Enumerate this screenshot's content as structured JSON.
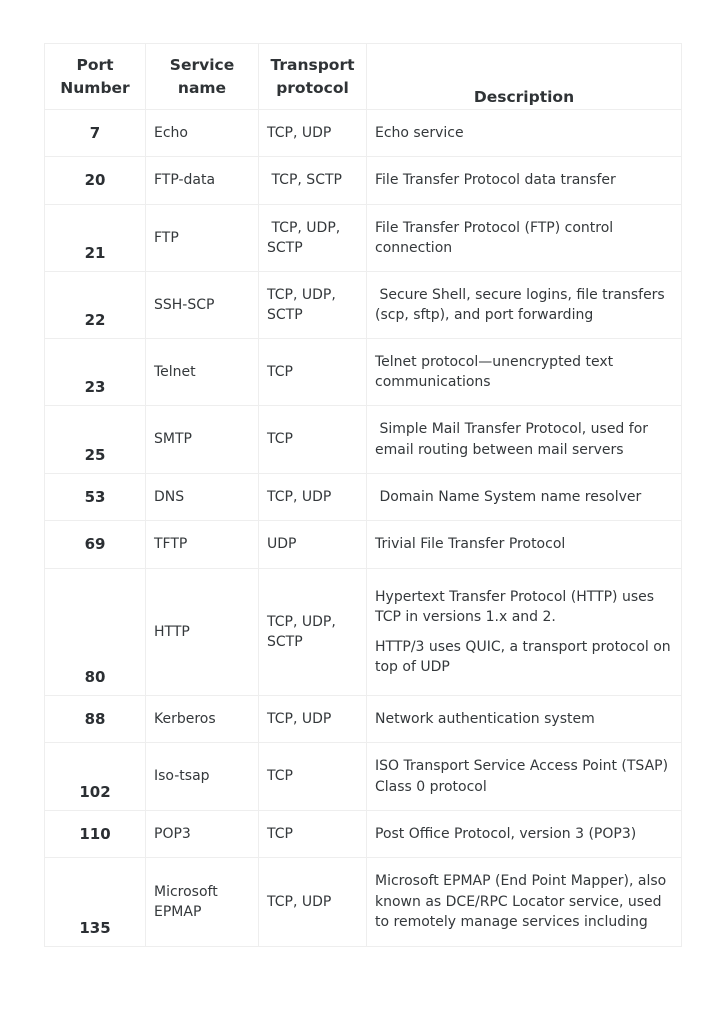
{
  "table": {
    "headers": [
      "Port Number",
      "Service name",
      "Transport protocol",
      "Description"
    ],
    "rows": [
      {
        "port": "7",
        "service": "Echo",
        "protocol": "TCP, UDP",
        "description": [
          "Echo service"
        ]
      },
      {
        "port": "20",
        "service": "FTP-data",
        "protocol": " TCP, SCTP",
        "description": [
          "File Transfer Protocol data transfer"
        ]
      },
      {
        "port": "21",
        "service": "FTP",
        "protocol": " TCP, UDP, SCTP",
        "description": [
          "File Transfer Protocol (FTP) control connection"
        ]
      },
      {
        "port": "22",
        "service": "SSH-SCP",
        "protocol": "TCP, UDP, SCTP",
        "description": [
          " Secure Shell, secure logins, file transfers (scp, sftp), and port forwarding"
        ]
      },
      {
        "port": "23",
        "service": "Telnet",
        "protocol": "TCP",
        "description": [
          "Telnet protocol—unencrypted text communications"
        ]
      },
      {
        "port": "25",
        "service": "SMTP",
        "protocol": "TCP",
        "description": [
          " Simple Mail Transfer Protocol, used for email routing between mail servers"
        ]
      },
      {
        "port": "53",
        "service": "DNS",
        "protocol": "TCP, UDP",
        "description": [
          " Domain Name System name resolver"
        ]
      },
      {
        "port": "69",
        "service": "TFTP",
        "protocol": "UDP",
        "description": [
          "Trivial File Transfer Protocol"
        ]
      },
      {
        "port": "80",
        "service": "HTTP",
        "protocol": "TCP, UDP, SCTP",
        "description": [
          "Hypertext Transfer Protocol (HTTP) uses TCP in versions 1.x and 2.",
          "HTTP/3 uses QUIC, a transport protocol on top of UDP"
        ]
      },
      {
        "port": "88",
        "service": "Kerberos",
        "protocol": "TCP, UDP",
        "description": [
          "Network authentication system"
        ]
      },
      {
        "port": "102",
        "service": "Iso-tsap",
        "protocol": "TCP",
        "description": [
          "ISO Transport Service Access Point (TSAP) Class 0 protocol"
        ]
      },
      {
        "port": "110",
        "service": "POP3",
        "protocol": "TCP",
        "description": [
          "Post Office Protocol, version 3 (POP3)"
        ]
      },
      {
        "port": "135",
        "service": "Microsoft EPMAP",
        "protocol": "TCP, UDP",
        "description": [
          "Microsoft EPMAP (End Point Mapper), also known as DCE/RPC Locator service, used to remotely manage services including"
        ]
      }
    ]
  }
}
